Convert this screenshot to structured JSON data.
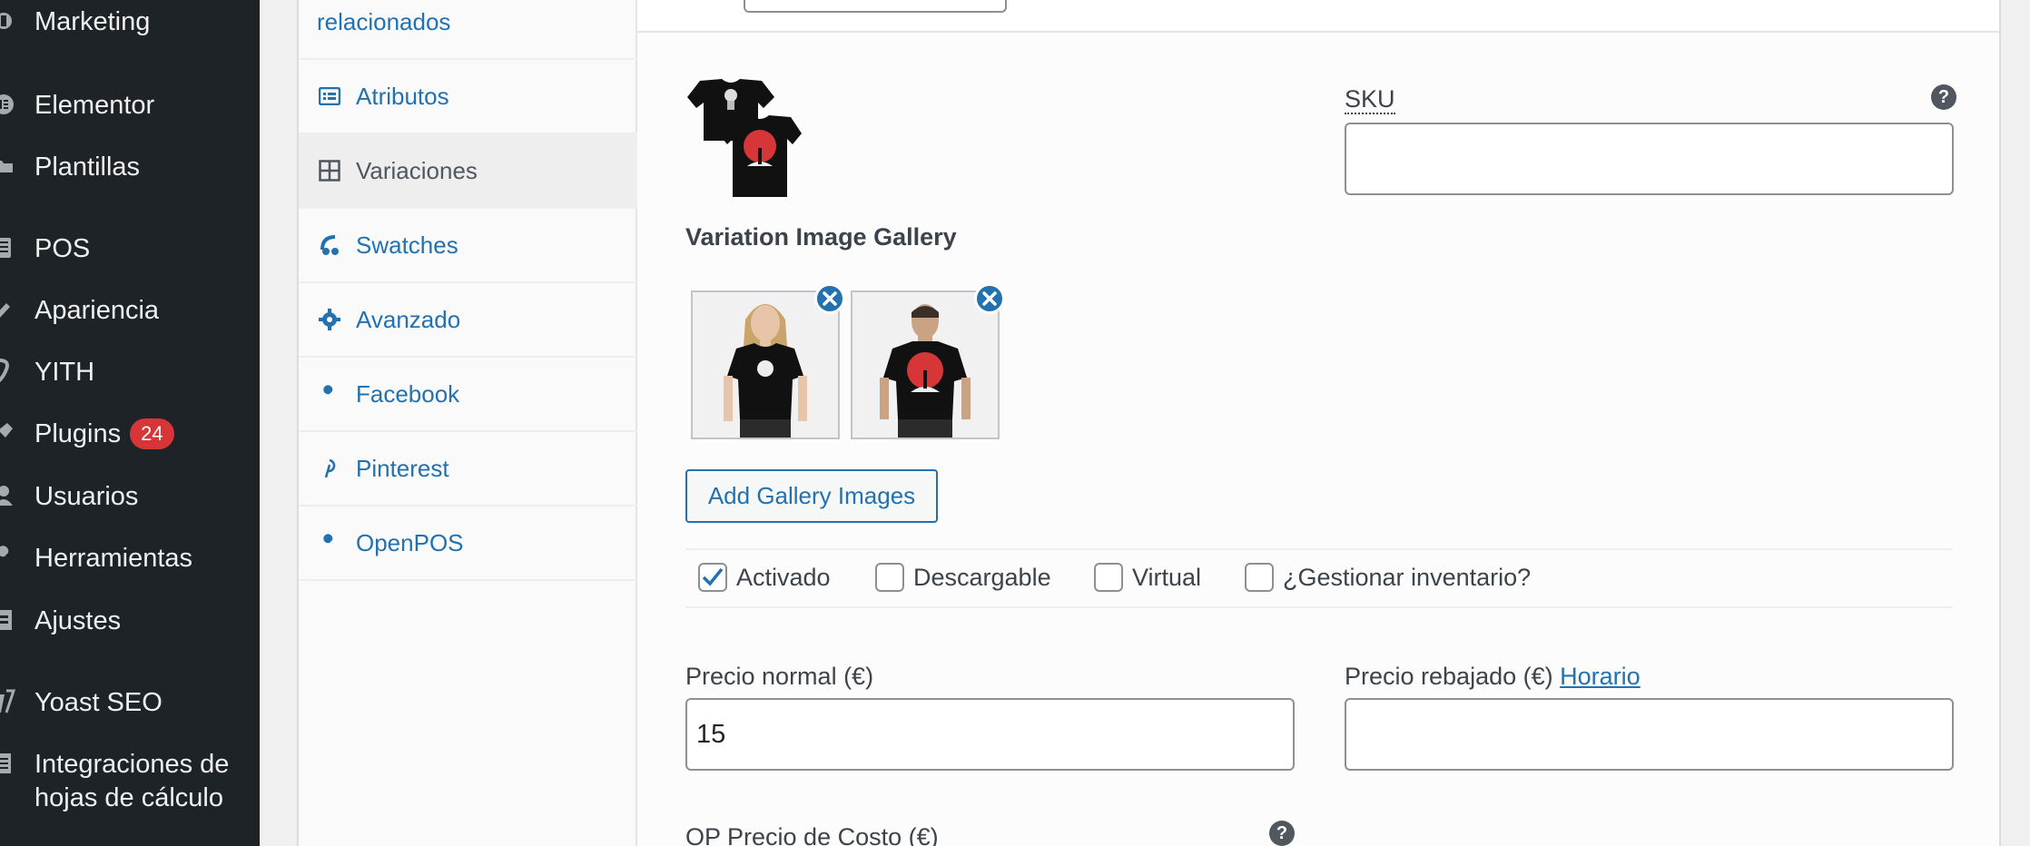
{
  "admin_menu": {
    "items": [
      {
        "label": "Marketing",
        "icon": "megaphone-icon"
      },
      {
        "label": "Elementor",
        "icon": "elementor-icon"
      },
      {
        "label": "Plantillas",
        "icon": "folder-icon"
      },
      {
        "label": "POS",
        "icon": "pos-icon"
      },
      {
        "label": "Apariencia",
        "icon": "paintbrush-icon"
      },
      {
        "label": "YITH",
        "icon": "yith-icon"
      },
      {
        "label": "Plugins",
        "icon": "plugin-icon",
        "badge": "24"
      },
      {
        "label": "Usuarios",
        "icon": "users-icon"
      },
      {
        "label": "Herramientas",
        "icon": "wrench-icon"
      },
      {
        "label": "Ajustes",
        "icon": "settings-icon"
      },
      {
        "label": "Yoast SEO",
        "icon": "yoast-icon"
      },
      {
        "label": "Integraciones de hojas de cálculo",
        "icon": "spreadsheet-icon"
      }
    ]
  },
  "product_tabs": {
    "items": [
      {
        "label": "relacionados",
        "icon": ""
      },
      {
        "label": "Atributos",
        "icon": "list-icon"
      },
      {
        "label": "Variaciones",
        "icon": "grid-icon",
        "active": true
      },
      {
        "label": "Swatches",
        "icon": "swatches-icon"
      },
      {
        "label": "Avanzado",
        "icon": "gear-icon"
      },
      {
        "label": "Facebook",
        "icon": "wrench-icon"
      },
      {
        "label": "Pinterest",
        "icon": "pinterest-icon"
      },
      {
        "label": "OpenPOS",
        "icon": "wrench-icon"
      }
    ]
  },
  "variation": {
    "sku_label": "SKU",
    "sku_value": "",
    "gallery_title": "Variation Image Gallery",
    "add_gallery_label": "Add Gallery Images",
    "options": [
      {
        "label": "Activado",
        "checked": true
      },
      {
        "label": "Descargable",
        "checked": false
      },
      {
        "label": "Virtual",
        "checked": false
      },
      {
        "label": "¿Gestionar inventario?",
        "checked": false
      }
    ],
    "regular_price_label": "Precio normal (€)",
    "regular_price_value": "15",
    "sale_price_label": "Precio rebajado (€)",
    "sale_price_link": "Horario",
    "sale_price_value": "",
    "cost_price_label": "OP Precio de Costo (€)",
    "help_glyph": "?"
  },
  "colors": {
    "admin_bg": "#1d2327",
    "link": "#2271b1",
    "badge": "#d63638"
  }
}
